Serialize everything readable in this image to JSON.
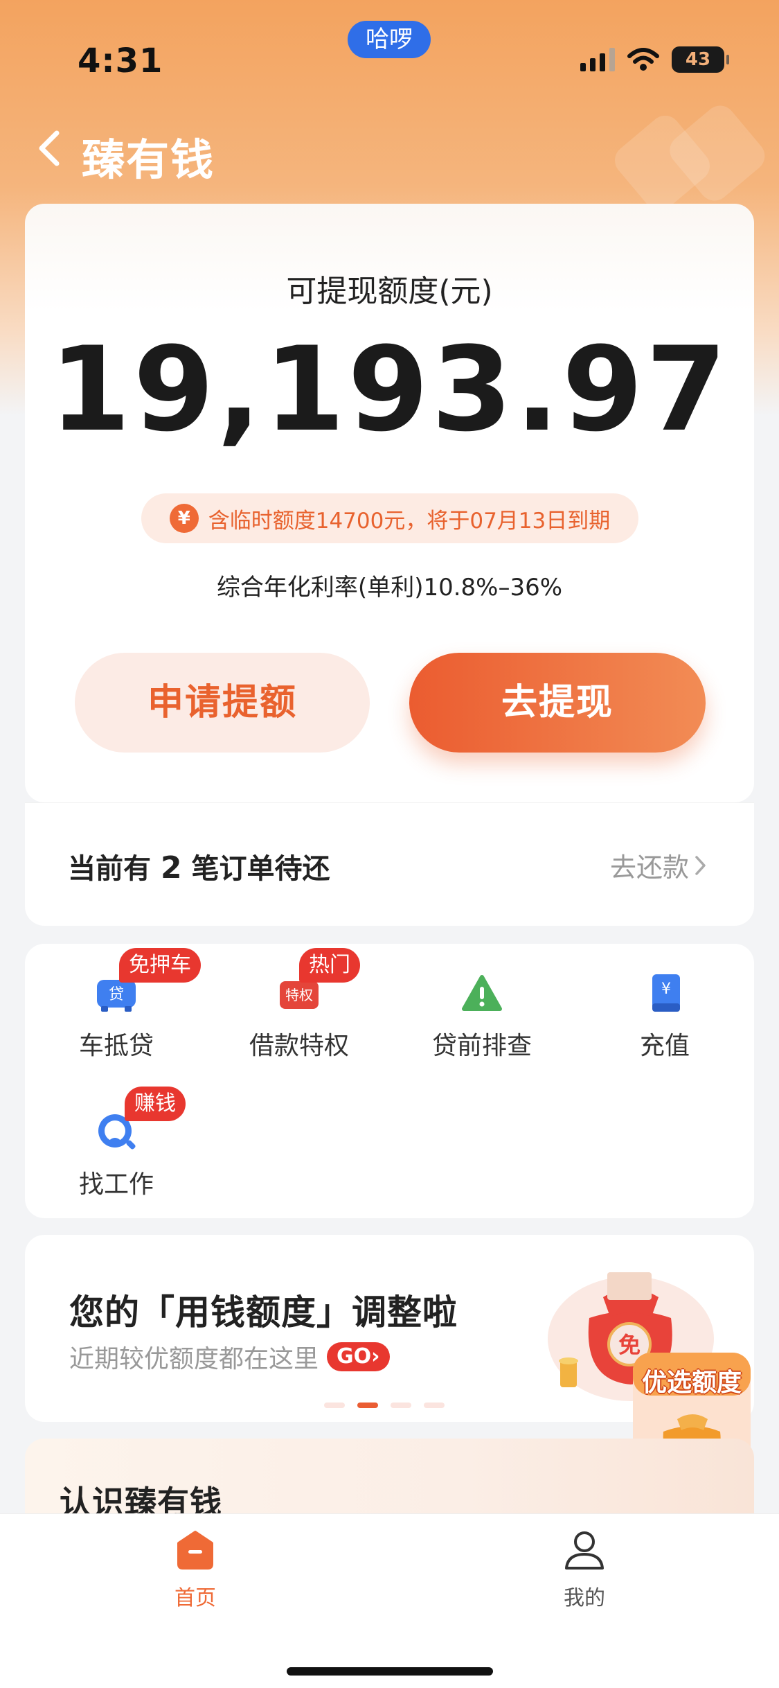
{
  "status_bar": {
    "time": "4:31",
    "center_pill": "哈啰",
    "battery": "43"
  },
  "nav": {
    "title": "臻有钱"
  },
  "quota": {
    "label": "可提现额度(元)",
    "amount": "19,193.97",
    "temporary_note": "含临时额度14700元，将于07月13日到期",
    "rate": "综合年化利率(单利)10.8%–36%",
    "apply_button": "申请提额",
    "withdraw_button": "去提现"
  },
  "orders": {
    "prefix": "当前有",
    "count": "2",
    "suffix": "笔订单待还",
    "repay_link": "去还款"
  },
  "services": [
    {
      "label": "车抵贷",
      "badge": "免押车",
      "icon_text": "贷"
    },
    {
      "label": "借款特权",
      "badge": "热门",
      "icon_text": "特权"
    },
    {
      "label": "贷前排查",
      "badge": "",
      "icon_text": "!"
    },
    {
      "label": "充值",
      "badge": "",
      "icon_text": "¥"
    },
    {
      "label": "找工作",
      "badge": "赚钱",
      "icon_text": ""
    }
  ],
  "banner": {
    "title": "您的「用钱额度」调整啦",
    "subtitle": "近期较优额度都在这里",
    "go_tag": "GO›",
    "bag_char": "免"
  },
  "float_promo": {
    "label": "优选额度"
  },
  "about": {
    "title": "认识臻有钱"
  },
  "tab_bar": {
    "home": "首页",
    "mine": "我的"
  },
  "colors": {
    "accent": "#eb5c30",
    "badge_red": "#e8372f",
    "header_orange": "#f3a35f"
  }
}
